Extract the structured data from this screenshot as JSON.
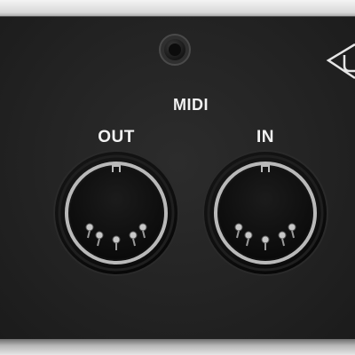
{
  "panel": {
    "group_label": "MIDI",
    "ports": [
      {
        "label": "OUT"
      },
      {
        "label": "IN"
      }
    ]
  },
  "icons": {
    "mounting_hole": "screw-hole-icon",
    "logo": "brand-logo-icon"
  },
  "colors": {
    "panel": "#232323",
    "label_text": "#f2f2f2",
    "chassis": "#d8d8d8"
  }
}
